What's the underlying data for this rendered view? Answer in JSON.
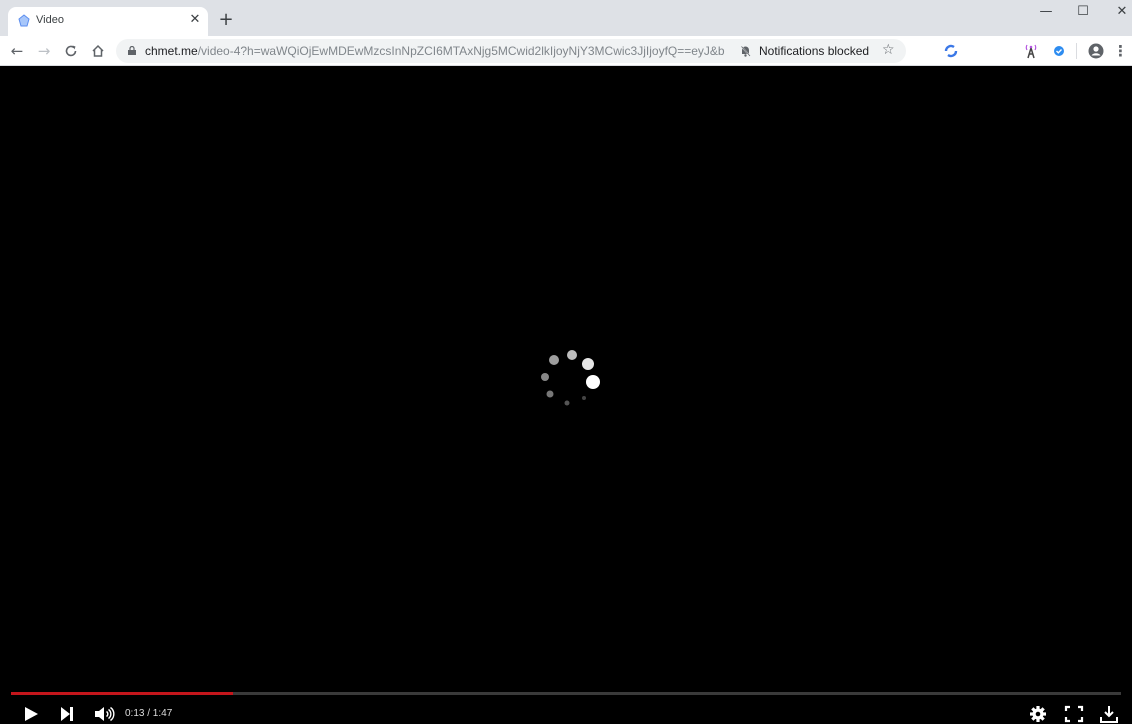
{
  "browser": {
    "tab": {
      "title": "Video",
      "favicon": "site-favicon-icon"
    },
    "new_tab_label": "+",
    "window_controls": {
      "minimize": "—",
      "maximize": "☐",
      "close": "✕"
    },
    "nav": {
      "back": "←",
      "forward": "→",
      "reload": "C",
      "home": "⌂"
    },
    "url": {
      "host": "chmet.me",
      "path": "/video-4?h=waWQiOjEwMDEwMzcsInNpZCI6MTAxNjg5MCwid2lkIjoyNjY3MCwic3JjIjoyfQ==eyJ&bb..."
    },
    "notifications_label": "Notifications blocked",
    "star": "☆",
    "extensions": [
      "sync-extension-icon",
      "antenna-extension-icon",
      "check-extension-icon"
    ],
    "profile": "profile-icon",
    "menu": "⋮"
  },
  "player": {
    "state": "loading",
    "time_current": "0:13",
    "time_total": "1:47",
    "time_display": "0:13 / 1:47",
    "progress_fraction": 0.2,
    "progress_color": "#c4161c",
    "controls": [
      "play",
      "next",
      "volume",
      "settings",
      "fullscreen",
      "download"
    ]
  }
}
